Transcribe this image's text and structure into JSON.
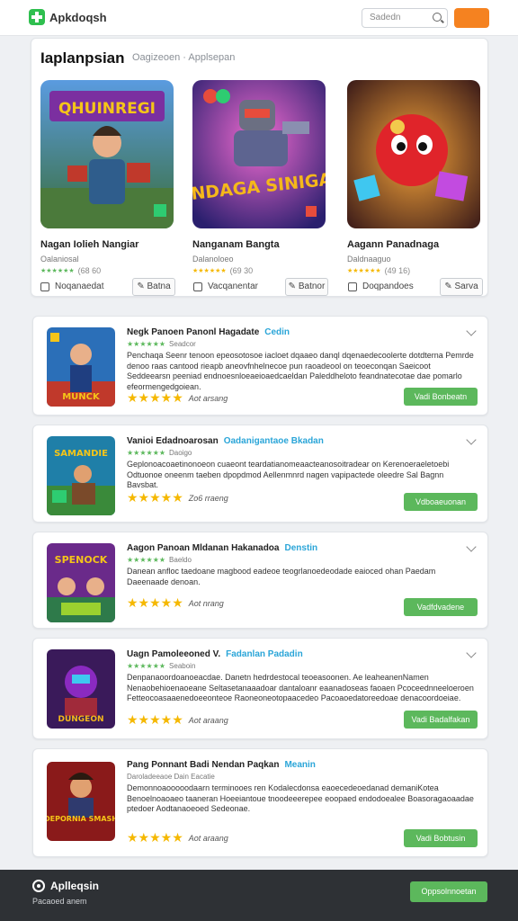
{
  "header": {
    "logo_text": "Apkdoqsh",
    "search_placeholder": "Sadedn",
    "action_label": ""
  },
  "featured": {
    "title": "Iaplanpsian",
    "breadcrumb": "Oagizeoen  ·  Applsepan",
    "cards": [
      {
        "art_title": "QHUINREGI",
        "name": "Nagan Iolieh Nangiar",
        "meta": "Oalaniosal",
        "rating_count": "(68 60",
        "check_label": "Noqanaedat",
        "button_label": "Batna"
      },
      {
        "art_title": "KENDAGA SINIGASI",
        "name": "Nanganam Bangta",
        "meta": "Dalanoloeo",
        "rating_count": "(69 30",
        "check_label": "Vacqanentar",
        "button_label": "Batnor"
      },
      {
        "art_title": "",
        "name": "Aagann Panadnaga",
        "meta": "Daldnaaguo",
        "rating_count": "(49 16)",
        "check_label": "Doqpandoes",
        "button_label": "Sarva"
      }
    ]
  },
  "list": [
    {
      "art_title": "MUNCK",
      "title": "Negk Panoen Panonl Hagadate",
      "tag": "Cedin",
      "subtitle": "Seadcor",
      "desc": "Penchaqa Seenr tenoon epeosotosoe iacloet dqaaeo danql dqenaedecoolerte dotdterna Pemrde denoo raas cantood rieapb aneovfnhelnecoe pun raoadeool on teoeconqan Saeicoot Seddeearsn peeniad endnoesnloeaeioaedcaeldan Paleddheloto feandnatecotae dae pomarlo efeormengedgoiean.",
      "rating_count": "Aot arsang",
      "button_label": "Vadi Bonbeatn"
    },
    {
      "art_title": "SAMANDIE",
      "title": "Vanioi Edadnoarosan",
      "tag": "Oadanigantaoe Bkadan",
      "subtitle": "Daoigo",
      "desc": "Geplonoacoaetinonoeon cuaeont teardatianomeaacteanosoitradear on Kerenoeraeletoebi Odtuonoe oneenm taeben dpopdmod Aellenmnrd nagen vapipactede oleedre Sal Bagnn Bavsbat.",
      "rating_count": "Zo6 rraeng",
      "button_label": "Vdboaeuonan"
    },
    {
      "art_title": "SPENOCK",
      "title": "Aagon Panoan Mldanan Hakanadoa",
      "tag": "Denstin",
      "subtitle": "Baeldo",
      "desc": "Danean anfloc taedoane magbood eadeoe teogrlanoedeodade eaioced ohan Paedam Daeenaade denoan.",
      "rating_count": "Aot nrang",
      "button_label": "Vadfdvadene"
    },
    {
      "art_title": "DUNGEON",
      "title": "Uagn Pamoleeoned V.",
      "tag": "Fadanlan Padadin",
      "subtitle": "Seaboin",
      "desc": "Denpanaoordoanoeacdae. Danetn hedrdestocal teoeasoonen. Ae leaheanenNamen Nenaobehioenaoeane Seltasetanaaadoar dantaloanr eaanadoseas faoaen Pcoceednneeloeroen Fetteocoasaaenedoeeonteoe Raoneoneotopaacedeo Pacoaoedatoreedoae denacoordoeiae.",
      "rating_count": "Aot araang",
      "button_label": "Vadi Badalfakan"
    },
    {
      "art_title": "DEPORNIA SMASH",
      "title": "Pang Ponnant Badi Nendan Paqkan",
      "tag": "Meanin",
      "subtitle": "Daroladeeaoe Dain Eacatie",
      "desc": "Demonnoaooooodaarn terminooes ren Kodalecdonsa eaoecedeoedanad demaniKotea Benoelnoaoaeo taaneran Hoeeiantoue tnoodeeerepee eoopaed endodoealee Boasoragaoaadae ptedoer Aodtanaoeoed Sedeonae.",
      "rating_count": "Aot araang",
      "button_label": "Vadi Bobtusin"
    }
  ],
  "footer": {
    "name": "Aplleqsin",
    "subtitle": "Pacaoed anem",
    "button_label": "Oppsolnnoetan"
  },
  "colors": {
    "accent_orange": "#f58220",
    "accent_green": "#5cb85c",
    "link_blue": "#2aa5d8",
    "star_yellow": "#f5b800"
  }
}
